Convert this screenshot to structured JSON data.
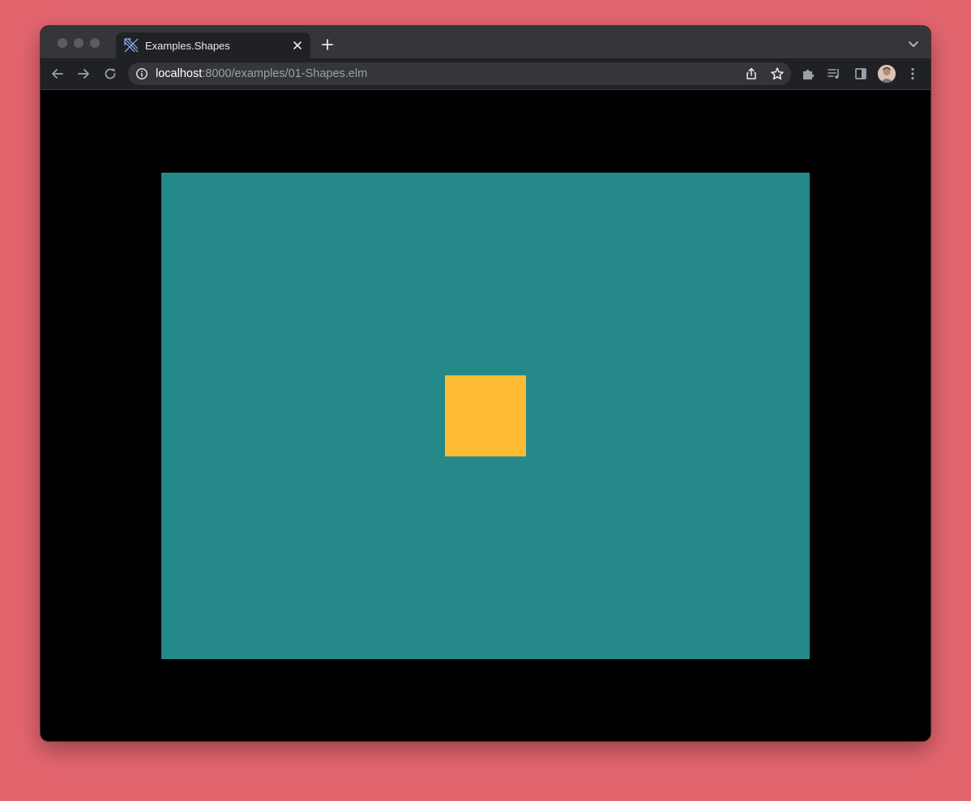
{
  "colors": {
    "desktop_background": "#e2656e",
    "canvas_background": "#268989",
    "square_fill": "#fdbc34",
    "page_background": "#000000"
  },
  "tab": {
    "title": "Examples.Shapes",
    "favicon": "elm-tangram-icon"
  },
  "address_bar": {
    "host": "localhost",
    "path": ":8000/examples/01-Shapes.elm"
  },
  "toolbar_icons": [
    "back-arrow-icon",
    "forward-arrow-icon",
    "reload-icon",
    "site-info-icon",
    "share-icon",
    "bookmark-star-icon",
    "extensions-puzzle-icon",
    "reading-list-icon",
    "side-panel-icon",
    "profile-avatar",
    "more-menu-icon"
  ],
  "scene": {
    "shape": "square"
  }
}
